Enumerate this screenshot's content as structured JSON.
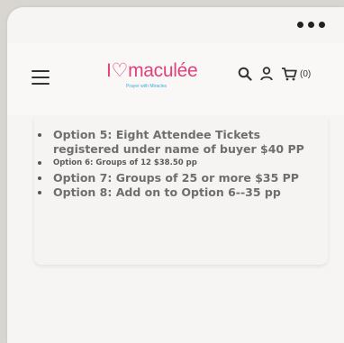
{
  "brand": {
    "name_part1": "I",
    "name_part2": "maculée",
    "tagline": "Prayer with Miracles",
    "pink": "#e0417d",
    "blue": "#3aa9d9"
  },
  "header": {
    "menu_icon": "hamburger-menu-icon",
    "cart_count": "(0)"
  },
  "options": [
    {
      "text": "Option 5: Eight Attendee Tickets registered under name of buyer $40 PP",
      "size": "big"
    },
    {
      "text": "Option 6: Groups of 12 $38.50 pp",
      "size": "small"
    },
    {
      "text": "Option 7: Groups of 25 or more $35 PP",
      "size": "big"
    },
    {
      "text": "Option 8: Add on to Option 6--35 pp",
      "size": "big"
    }
  ]
}
